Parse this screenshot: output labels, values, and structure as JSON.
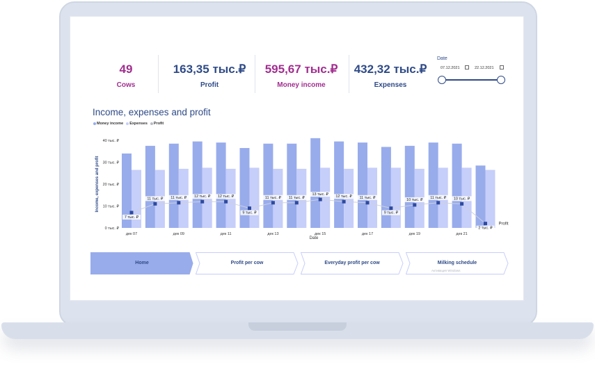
{
  "kpis": [
    {
      "value": "49",
      "label": "Cows",
      "color": "#a12e8f"
    },
    {
      "value": "163,35 тыс.₽",
      "label": "Profit",
      "color": "#2e4a87"
    },
    {
      "value": "595,67 тыс.₽",
      "label": "Money income",
      "color": "#a12e8f"
    },
    {
      "value": "432,32 тыс.₽",
      "label": "Expenses",
      "color": "#2e4a87"
    }
  ],
  "date_filter": {
    "label": "Date",
    "start": "07.12.2021",
    "end": "22.12.2021"
  },
  "chart_data": {
    "type": "bar",
    "title": "Income, expenses and profit",
    "legend": [
      "Money income",
      "Expenses",
      "Profit"
    ],
    "ylabel": "Income, expenses and profit",
    "xlabel": "Date",
    "ylim": [
      0,
      40
    ],
    "y_ticks": [
      "0 тыс. ₽",
      "10 тыс. ₽",
      "20 тыс. ₽",
      "30 тыс. ₽",
      "40 тыс. ₽"
    ],
    "x_tick_labels": [
      "дек 07",
      "дек 09",
      "дек 11",
      "дек 13",
      "дек 15",
      "дек 17",
      "дек 19",
      "дек 21"
    ],
    "series": [
      {
        "name": "Money income",
        "color": "#98acec",
        "values": [
          34,
          37.5,
          38.5,
          39.5,
          39,
          36.5,
          38.5,
          38.5,
          41,
          39.5,
          39,
          37,
          37.5,
          39,
          38.5,
          28.5
        ]
      },
      {
        "name": "Expenses",
        "color": "#c6cefa",
        "values": [
          26.5,
          26.5,
          27,
          27.5,
          27,
          27.5,
          27,
          27,
          27.5,
          27,
          27.5,
          27.5,
          27,
          27.5,
          27.5,
          26.5
        ]
      },
      {
        "name": "Profit",
        "color": "#2e4aa0",
        "values": [
          7,
          11,
          11.5,
          12,
          12,
          9,
          11.5,
          11.5,
          13,
          12,
          11.5,
          9,
          10.5,
          11.5,
          11,
          2
        ]
      }
    ],
    "profit_labels": [
      "7 тыс. ₽",
      "11 тыс. ₽",
      "11 тыс. ₽",
      "12 тыс. ₽",
      "12 тыс. ₽",
      "9 тыс. ₽",
      "11 тыс. ₽",
      "11 тыс. ₽",
      "13 тыс. ₽",
      "12 тыс. ₽",
      "11 тыс. ₽",
      "9 тыс. ₽",
      "10 тыс. ₽",
      "11 тыс. ₽",
      "10 тыс. ₽",
      "2 тыс. ₽"
    ],
    "end_label": "Profit"
  },
  "nav": [
    {
      "label": "Home",
      "active": true
    },
    {
      "label": "Profit per cow",
      "active": false
    },
    {
      "label": "Everyday profit per cow",
      "active": false
    },
    {
      "label": "Milking schedule",
      "active": false
    }
  ],
  "watermark": "Активация Windows"
}
